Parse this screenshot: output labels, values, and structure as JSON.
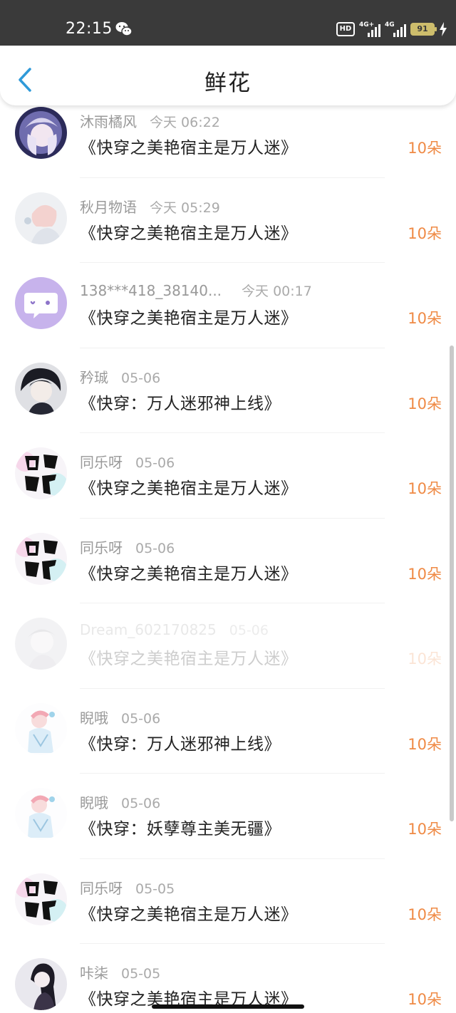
{
  "status_bar": {
    "time": "22:15",
    "icons": [
      "wechat-icon",
      "hd-voice-icon",
      "signal-4g-icon",
      "signal-4g-icon",
      "battery-icon",
      "charging-icon"
    ],
    "hd_label": "HD",
    "network_1": "4G+",
    "network_2": "4G",
    "battery_level": "91",
    "battery_color": "#cdbd6c"
  },
  "header": {
    "title": "鲜花",
    "back_icon": "chevron-left-icon",
    "accent": "#2f9ad9"
  },
  "flower_list": [
    {
      "user": "沐雨橘风",
      "time": "今天 06:22",
      "book": "《快穿之美艳宿主是万人迷》",
      "amount": "10朵",
      "avatar": "anime-girl-purple"
    },
    {
      "user": "秋月物语",
      "time": "今天 05:29",
      "book": "《快穿之美艳宿主是万人迷》",
      "amount": "10朵",
      "avatar": "anime-girl-pink"
    },
    {
      "user": "138***418_38140...",
      "time": "今天 00:17",
      "book": "《快穿之美艳宿主是万人迷》",
      "amount": "10朵",
      "avatar": "default-chat"
    },
    {
      "user": "矜珹",
      "time": "05-06",
      "book": "《快穿：万人迷邪神上线》",
      "amount": "10朵",
      "avatar": "anime-boy-dark"
    },
    {
      "user": "同乐呀",
      "time": "05-06",
      "book": "《快穿之美艳宿主是万人迷》",
      "amount": "10朵",
      "avatar": "calligraphy"
    },
    {
      "user": "同乐呀",
      "time": "05-06",
      "book": "《快穿之美艳宿主是万人迷》",
      "amount": "10朵",
      "avatar": "calligraphy"
    },
    {
      "user": "Dream_602170825",
      "time": "05-06",
      "book": "《快穿之美艳宿主是万人迷》",
      "amount": "10朵",
      "avatar": "faded-sketch",
      "faded": true
    },
    {
      "user": "睨哦",
      "time": "05-06",
      "book": "《快穿：万人迷邪神上线》",
      "amount": "10朵",
      "avatar": "sketch-pastel"
    },
    {
      "user": "睨哦",
      "time": "05-06",
      "book": "《快穿：妖孽尊主美无疆》",
      "amount": "10朵",
      "avatar": "sketch-pastel"
    },
    {
      "user": "同乐呀",
      "time": "05-05",
      "book": "《快穿之美艳宿主是万人迷》",
      "amount": "10朵",
      "avatar": "calligraphy"
    },
    {
      "user": "咔柒",
      "time": "05-05",
      "book": "《快穿之美艳宿主是万人迷》",
      "amount": "10朵",
      "avatar": "anime-girl-dark"
    }
  ],
  "colors": {
    "amount": "#ef8a45",
    "title": "#1f1f1f",
    "meta": "#999999",
    "status_bg": "#3a3a3a"
  }
}
